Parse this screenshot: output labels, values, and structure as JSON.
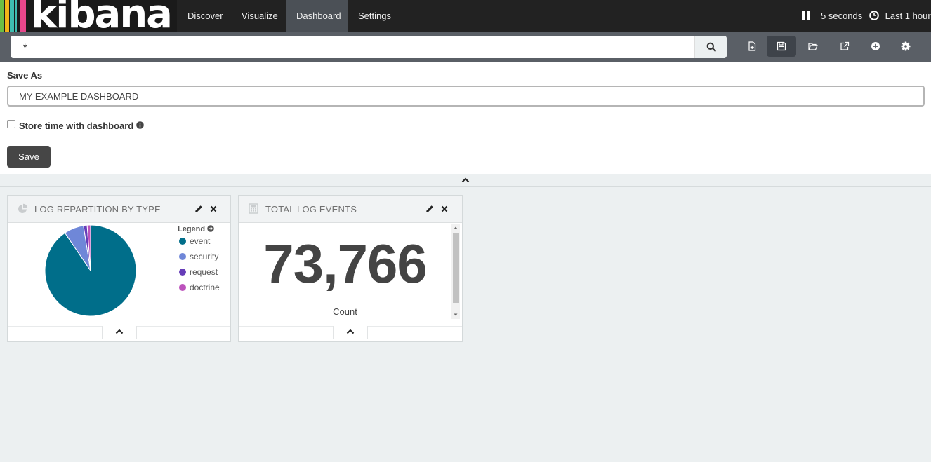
{
  "app": {
    "logo_text": "kibana",
    "logo_bar_colors": [
      "#e8478b",
      "#f2b419",
      "#3ebeb0",
      "#80c342",
      "#f04e98"
    ]
  },
  "nav": {
    "items": [
      {
        "label": "Discover",
        "active": false
      },
      {
        "label": "Visualize",
        "active": false
      },
      {
        "label": "Dashboard",
        "active": true
      },
      {
        "label": "Settings",
        "active": false
      }
    ],
    "refresh_label": "5 seconds",
    "time_label": "Last 1 hour"
  },
  "query": {
    "value": "*",
    "icons": [
      "new-dashboard-icon",
      "save-icon",
      "open-icon",
      "share-icon",
      "add-visualization-icon",
      "options-icon"
    ]
  },
  "save_panel": {
    "label": "Save As",
    "input_value": "MY EXAMPLE DASHBOARD",
    "store_time_label": "Store time with dashboard",
    "store_time_checked": false,
    "save_button": "Save"
  },
  "panels": {
    "pie": {
      "title": "LOG REPARTITION BY TYPE",
      "legend_title": "Legend",
      "legend": [
        {
          "label": "event",
          "color": "#006e8a"
        },
        {
          "label": "security",
          "color": "#6f87d8"
        },
        {
          "label": "request",
          "color": "#663db8"
        },
        {
          "label": "doctrine",
          "color": "#bc52bc"
        }
      ]
    },
    "metric": {
      "title": "TOTAL LOG EVENTS",
      "value": "73,766",
      "label": "Count"
    }
  },
  "chart_data": {
    "type": "pie",
    "categories": [
      "event",
      "security",
      "request",
      "doctrine"
    ],
    "values": [
      90.5,
      7.0,
      1.3,
      1.2
    ],
    "colors": [
      "#006e8a",
      "#6f87d8",
      "#663db8",
      "#bc52bc"
    ],
    "title": "LOG REPARTITION BY TYPE",
    "legend": "right"
  }
}
